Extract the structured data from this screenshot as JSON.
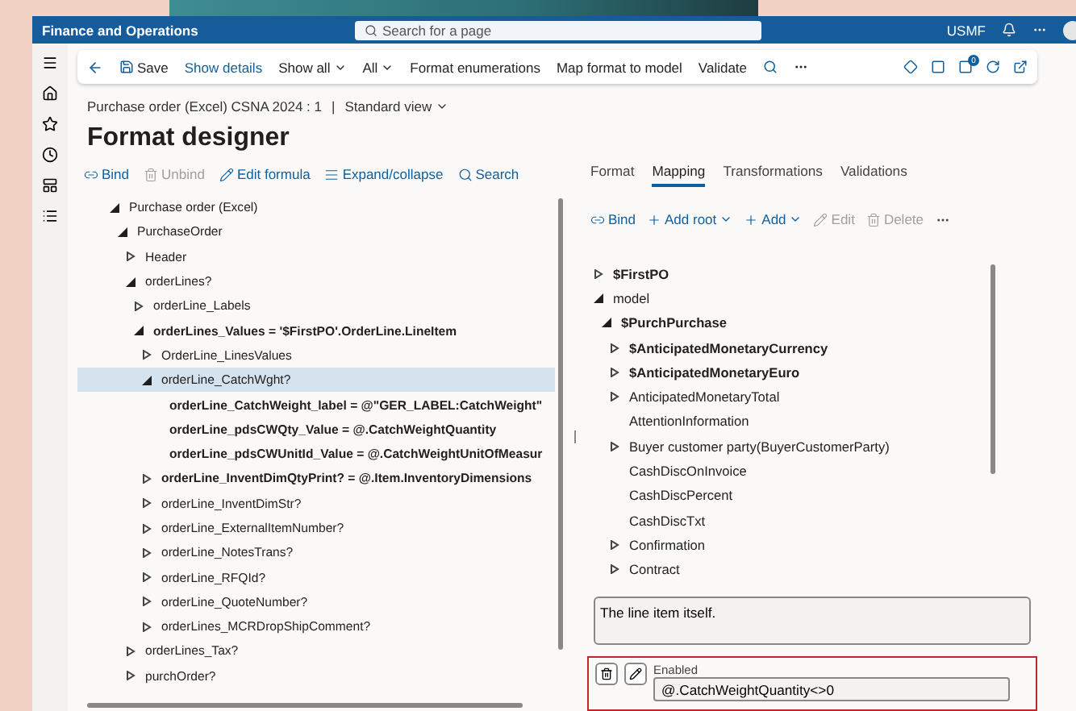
{
  "header": {
    "title": "Finance and Operations",
    "search_placeholder": "Search for a page",
    "company": "USMF"
  },
  "toolbar": {
    "items": [
      {
        "label": "Save",
        "kind": "save"
      },
      {
        "label": "Show details",
        "kind": "link"
      },
      {
        "label": "Show all",
        "kind": "dropdown"
      },
      {
        "label": "All",
        "kind": "dropdown"
      },
      {
        "label": "Format enumerations",
        "kind": "plain"
      },
      {
        "label": "Map format to model",
        "kind": "plain"
      },
      {
        "label": "Validate",
        "kind": "plain"
      }
    ],
    "badge": "0"
  },
  "breadcrumb": {
    "path": "Purchase order (Excel) CSNA 2024 : 1",
    "separator": "|",
    "view": "Standard view"
  },
  "page_title": "Format designer",
  "left_actions": [
    {
      "label": "Bind",
      "disabled": false
    },
    {
      "label": "Unbind",
      "disabled": true
    },
    {
      "label": "Edit formula",
      "disabled": false
    },
    {
      "label": "Expand/collapse",
      "disabled": false
    },
    {
      "label": "Search",
      "disabled": false
    }
  ],
  "left_tree": [
    {
      "label": "Purchase order (Excel)",
      "kind": "expanded",
      "bold": false,
      "selected": false,
      "children": [
        {
          "label": "PurchaseOrder",
          "kind": "expanded",
          "bold": false,
          "selected": false,
          "children": [
            {
              "label": "Header",
              "kind": "collapsed",
              "bold": false,
              "selected": false
            },
            {
              "label": "orderLines?",
              "kind": "expanded",
              "bold": false,
              "selected": false,
              "children": [
                {
                  "label": "orderLine_Labels",
                  "kind": "collapsed",
                  "bold": false,
                  "selected": false
                },
                {
                  "label": "orderLines_Values = '$FirstPO'.OrderLine.LineItem",
                  "kind": "expanded",
                  "bold": true,
                  "selected": false,
                  "children": [
                    {
                      "label": "OrderLine_LinesValues",
                      "kind": "collapsed",
                      "bold": false,
                      "selected": false
                    },
                    {
                      "label": "orderLine_CatchWght?",
                      "kind": "expanded",
                      "bold": false,
                      "selected": true,
                      "children": [
                        {
                          "label": "orderLine_CatchWeight_label = @\"GER_LABEL:CatchWeight\"",
                          "kind": "leaf",
                          "bold": true,
                          "selected": false
                        },
                        {
                          "label": "orderLine_pdsCWQty_Value = @.CatchWeightQuantity",
                          "kind": "leaf",
                          "bold": true,
                          "selected": false
                        },
                        {
                          "label": "orderLine_pdsCWUnitId_Value = @.CatchWeightUnitOfMeasur",
                          "kind": "leaf",
                          "bold": true,
                          "selected": false
                        }
                      ]
                    },
                    {
                      "label": "orderLine_InventDimQtyPrint? = @.Item.InventoryDimensions",
                      "kind": "collapsed",
                      "bold": true,
                      "selected": false
                    },
                    {
                      "label": "orderLine_InventDimStr?",
                      "kind": "collapsed",
                      "bold": false,
                      "selected": false
                    },
                    {
                      "label": "orderLine_ExternalItemNumber?",
                      "kind": "collapsed",
                      "bold": false,
                      "selected": false
                    },
                    {
                      "label": "orderLine_NotesTrans?",
                      "kind": "collapsed",
                      "bold": false,
                      "selected": false
                    },
                    {
                      "label": "orderLine_RFQId?",
                      "kind": "collapsed",
                      "bold": false,
                      "selected": false
                    },
                    {
                      "label": "orderLine_QuoteNumber?",
                      "kind": "collapsed",
                      "bold": false,
                      "selected": false
                    },
                    {
                      "label": "orderLines_MCRDropShipComment?",
                      "kind": "collapsed",
                      "bold": false,
                      "selected": false
                    }
                  ]
                }
              ]
            },
            {
              "label": "orderLines_Tax?",
              "kind": "collapsed",
              "bold": false,
              "selected": false
            },
            {
              "label": "purchOrder?",
              "kind": "collapsed",
              "bold": false,
              "selected": false
            }
          ]
        }
      ]
    }
  ],
  "tabs": [
    {
      "label": "Format",
      "selected": false
    },
    {
      "label": "Mapping",
      "selected": true
    },
    {
      "label": "Transformations",
      "selected": false
    },
    {
      "label": "Validations",
      "selected": false
    }
  ],
  "right_actions": [
    {
      "label": "Bind",
      "disabled": false,
      "dropdown": false
    },
    {
      "label": "Add root",
      "disabled": false,
      "dropdown": true
    },
    {
      "label": "Add",
      "disabled": false,
      "dropdown": true
    },
    {
      "label": "Edit",
      "disabled": true,
      "dropdown": false
    },
    {
      "label": "Delete",
      "disabled": true,
      "dropdown": false
    }
  ],
  "right_tree": [
    {
      "label": "$FirstPO",
      "kind": "collapsed",
      "bold": true
    },
    {
      "label": "model",
      "kind": "expanded",
      "bold": false,
      "children": [
        {
          "label": "$PurchPurchase",
          "kind": "expanded",
          "bold": true,
          "children": [
            {
              "label": "$AnticipatedMonetaryCurrency",
              "kind": "collapsed",
              "bold": true
            },
            {
              "label": "$AnticipatedMonetaryEuro",
              "kind": "collapsed",
              "bold": true
            },
            {
              "label": "AnticipatedMonetaryTotal",
              "kind": "collapsed",
              "bold": false
            },
            {
              "label": "AttentionInformation",
              "kind": "leaf",
              "bold": false
            },
            {
              "label": "Buyer customer party(BuyerCustomerParty)",
              "kind": "collapsed",
              "bold": false
            },
            {
              "label": "CashDiscOnInvoice",
              "kind": "leaf",
              "bold": false
            },
            {
              "label": "CashDiscPercent",
              "kind": "leaf",
              "bold": false
            },
            {
              "label": "CashDiscTxt",
              "kind": "leaf",
              "bold": false
            },
            {
              "label": "Confirmation",
              "kind": "collapsed",
              "bold": false
            },
            {
              "label": "Contract",
              "kind": "collapsed",
              "bold": false
            }
          ]
        }
      ]
    }
  ],
  "description": "The line item itself.",
  "enabled_condition": {
    "label": "Enabled",
    "value": "@.CatchWeightQuantity<>0"
  }
}
